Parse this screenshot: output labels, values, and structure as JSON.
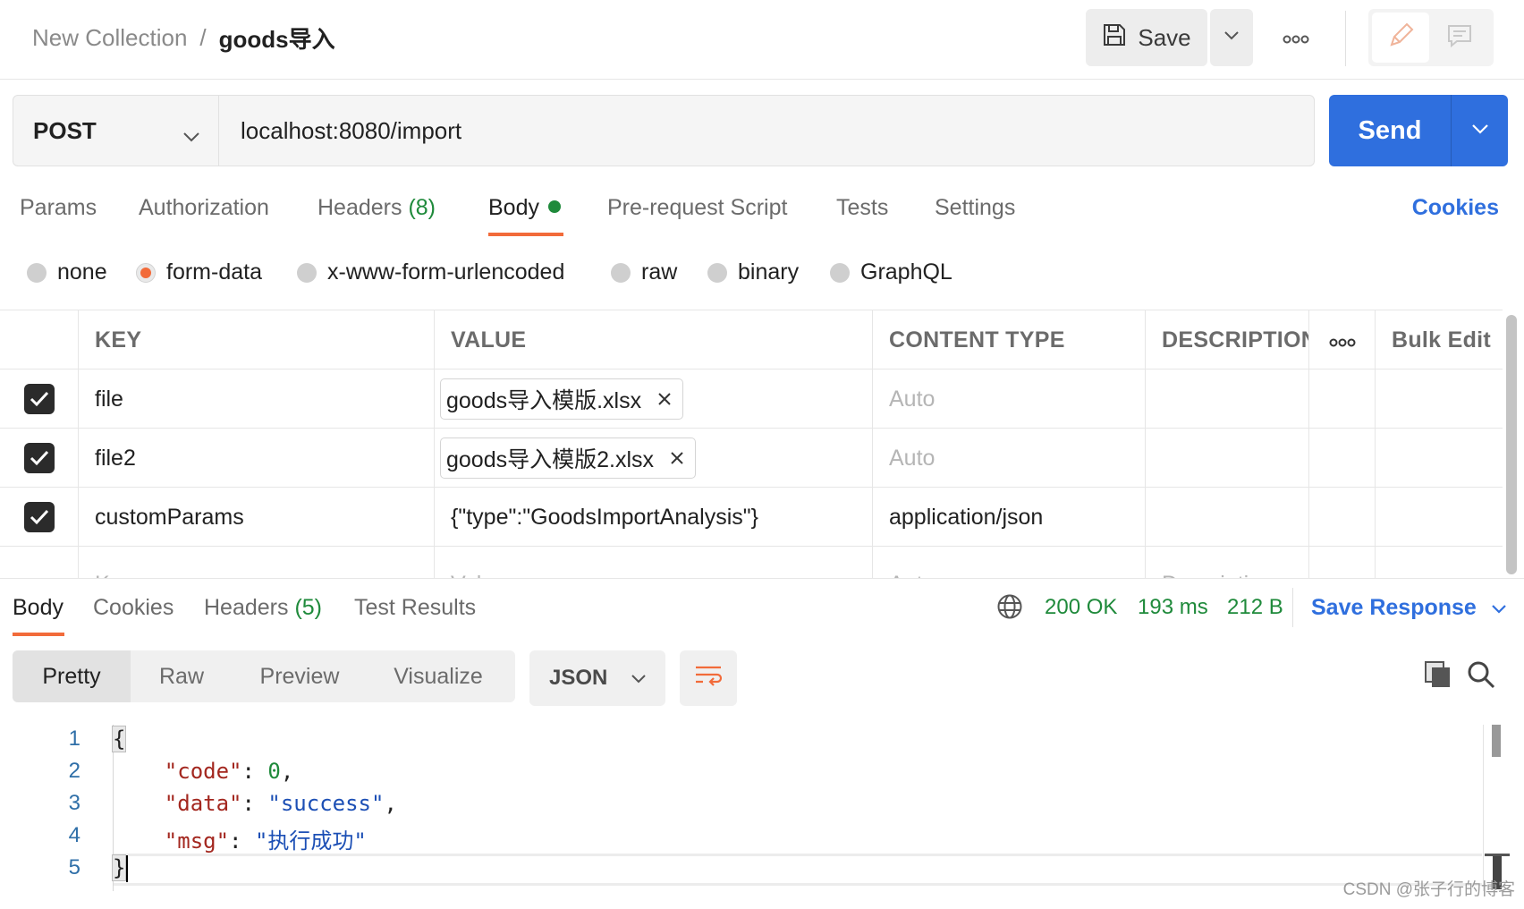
{
  "header": {
    "breadcrumb_parent": "New Collection",
    "breadcrumb_separator": "/",
    "breadcrumb_current": "goods导入",
    "save_label": "Save",
    "more_icon": "more-horizontal-icon"
  },
  "request": {
    "method": "POST",
    "url": "localhost:8080/import",
    "send_label": "Send"
  },
  "request_tabs": [
    {
      "label": "Params"
    },
    {
      "label": "Authorization"
    },
    {
      "label": "Headers",
      "count": "(8)"
    },
    {
      "label": "Body",
      "active": true
    },
    {
      "label": "Pre-request Script"
    },
    {
      "label": "Tests"
    },
    {
      "label": "Settings"
    }
  ],
  "cookies_label": "Cookies",
  "body_types": [
    {
      "label": "none"
    },
    {
      "label": "form-data",
      "selected": true
    },
    {
      "label": "x-www-form-urlencoded"
    },
    {
      "label": "raw"
    },
    {
      "label": "binary"
    },
    {
      "label": "GraphQL"
    }
  ],
  "params_table": {
    "headers": {
      "key": "KEY",
      "value": "VALUE",
      "content_type": "CONTENT TYPE",
      "description": "DESCRIPTION",
      "bulk_edit": "Bulk Edit"
    },
    "rows": [
      {
        "checked": true,
        "key": "file",
        "value": "goods导入模版.xlsx",
        "is_file": true,
        "content_type": "Auto",
        "content_type_placeholder": true,
        "description": ""
      },
      {
        "checked": true,
        "key": "file2",
        "value": "goods导入模版2.xlsx",
        "is_file": true,
        "content_type": "Auto",
        "content_type_placeholder": true,
        "description": ""
      },
      {
        "checked": true,
        "key": "customParams",
        "value": "{\"type\":\"GoodsImportAnalysis\"}",
        "is_file": false,
        "content_type": "application/json",
        "content_type_placeholder": false,
        "description": ""
      }
    ],
    "placeholder_row": {
      "key": "Key",
      "value": "Value",
      "content_type": "Auto",
      "description": "Description"
    }
  },
  "response": {
    "tabs": [
      {
        "label": "Body",
        "active": true
      },
      {
        "label": "Cookies"
      },
      {
        "label": "Headers",
        "count": "(5)"
      },
      {
        "label": "Test Results"
      }
    ],
    "status": "200 OK",
    "time": "193 ms",
    "size": "212 B",
    "save_response_label": "Save Response",
    "view_modes": [
      "Pretty",
      "Raw",
      "Preview",
      "Visualize"
    ],
    "active_view": "Pretty",
    "format": "JSON",
    "line_numbers": [
      "1",
      "2",
      "3",
      "4",
      "5"
    ],
    "json": {
      "open_brace": "{",
      "close_brace": "}",
      "entries": [
        {
          "key": "\"code\"",
          "value": "0",
          "type": "number",
          "comma": ","
        },
        {
          "key": "\"data\"",
          "value": "\"success\"",
          "type": "string",
          "comma": ","
        },
        {
          "key": "\"msg\"",
          "value": "\"执行成功\"",
          "type": "string",
          "comma": ""
        }
      ]
    }
  },
  "watermark": "CSDN @张子行的博客",
  "colors": {
    "accent_blue": "#2f6fde",
    "accent_orange": "#f26b3a",
    "status_green": "#1f8a3b"
  }
}
